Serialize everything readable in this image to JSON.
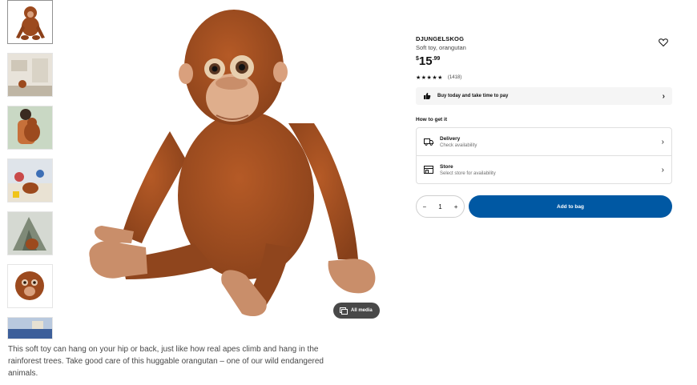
{
  "product": {
    "name": "DJUNGELSKOG",
    "subtitle": "Soft toy, orangutan",
    "price_currency": "$",
    "price_integer": "15",
    "price_decimal": ".99",
    "rating_stars": "★★★★★",
    "rating_count": "(1418)"
  },
  "pay_banner": {
    "label": "Buy today and take time to pay"
  },
  "how_to_get": {
    "title": "How to get it",
    "delivery": {
      "label": "Delivery",
      "sublabel": "Check availability"
    },
    "store": {
      "label": "Store",
      "sublabel": "Select store for availability"
    }
  },
  "quantity": {
    "minus": "−",
    "value": "1",
    "plus": "+"
  },
  "add_to_bag_label": "Add to bag",
  "gallery": {
    "all_media_label": "All media"
  },
  "description": "This soft toy can hang on your hip or back, just like how real apes climb and hang in the rainforest trees. Take good care of this huggable orangutan – one of our wild endangered animals.",
  "icons": {
    "favorite": "heart-icon",
    "pay": "thumb-up-icon",
    "delivery": "truck-icon",
    "store": "store-icon",
    "chevron": "chevron-right-icon",
    "media": "gallery-icon"
  },
  "colors": {
    "accent": "#0058a3",
    "fur": "#9c4a1e",
    "skin": "#d9a07d",
    "media_pill": "#484848"
  }
}
